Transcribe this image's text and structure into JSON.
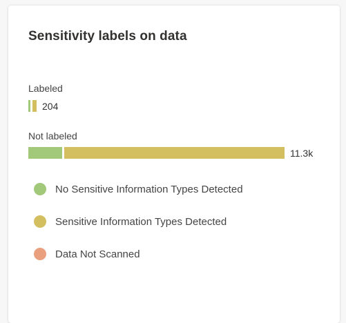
{
  "card": {
    "title": "Sensitivity labels on data"
  },
  "colors": {
    "no_sensitive": "#a2c97a",
    "sensitive": "#d3bf60",
    "not_scanned": "#ea9f7e"
  },
  "chart_data": {
    "type": "bar",
    "orientation": "horizontal",
    "stacked": true,
    "categories": [
      "Labeled",
      "Not labeled"
    ],
    "series": [
      {
        "name": "No Sensitive Information Types Detected",
        "values": [
          30,
          1500
        ]
      },
      {
        "name": "Sensitive Information Types Detected",
        "values": [
          174,
          9800
        ]
      },
      {
        "name": "Data Not Scanned",
        "values": [
          0,
          0
        ]
      }
    ],
    "totals_labels": [
      "204",
      "11.3k"
    ]
  },
  "legend": {
    "items": [
      {
        "label": "No Sensitive Information Types Detected"
      },
      {
        "label": "Sensitive Information Types Detected"
      },
      {
        "label": "Data Not Scanned"
      }
    ]
  }
}
